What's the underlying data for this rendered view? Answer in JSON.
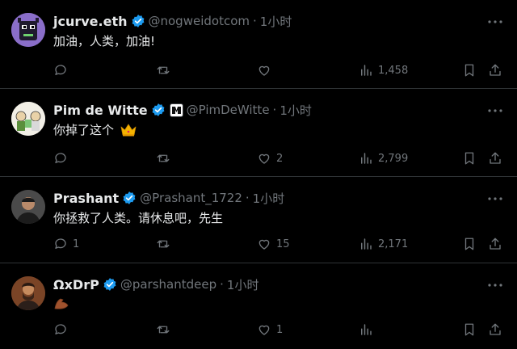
{
  "tweets": [
    {
      "name": "jcurve.eth",
      "handle": "@nogweidotcom",
      "separator": "·",
      "time": "1小时",
      "text": "加油，人类，加油!",
      "reply_count": "",
      "retweet_count": "",
      "like_count": "",
      "views": "1,458"
    },
    {
      "name": "Pim de Witte",
      "handle": "@PimDeWitte",
      "separator": "·",
      "time": "1小时",
      "text": "你掉了这个",
      "reply_count": "",
      "retweet_count": "",
      "like_count": "2",
      "views": "2,799"
    },
    {
      "name": "Prashant",
      "handle": "@Prashant_1722",
      "separator": "·",
      "time": "1小时",
      "text": "你拯救了人类。请休息吧，先生",
      "reply_count": "1",
      "retweet_count": "",
      "like_count": "15",
      "views": "2,171"
    },
    {
      "name": "ΩxDrP",
      "handle": "@parshantdeep",
      "separator": "·",
      "time": "1小时",
      "text": "",
      "reply_count": "",
      "retweet_count": "",
      "like_count": "1",
      "views": ""
    }
  ],
  "colors": {
    "background": "#000000",
    "text": "#e7e9ea",
    "muted": "#71767b",
    "divider": "#2f3336",
    "verified": "#1d9bf0"
  }
}
